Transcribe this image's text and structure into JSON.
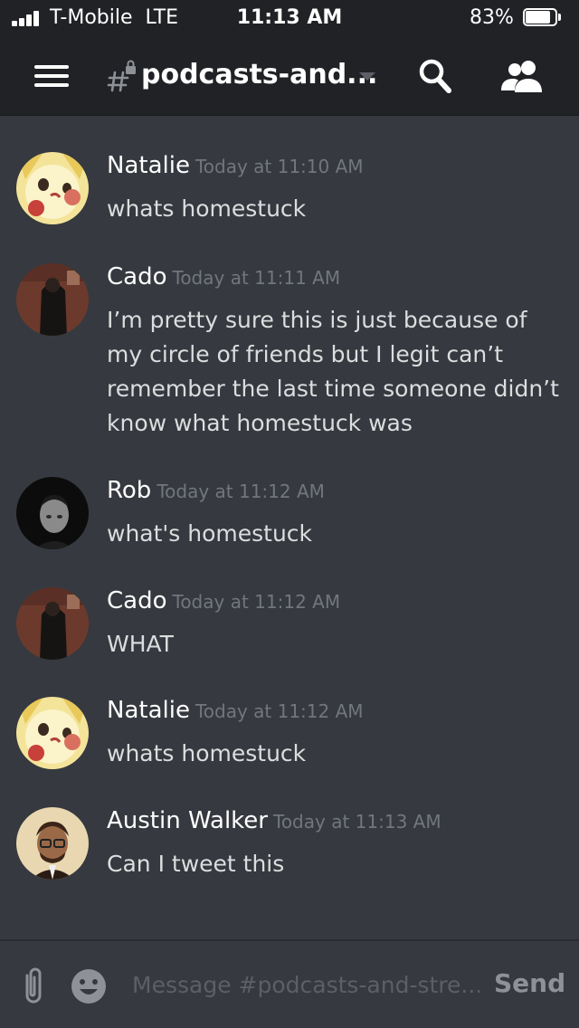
{
  "status_bar": {
    "carrier": "T-Mobile  LTE",
    "time": "11:13 AM",
    "battery": "83%",
    "battery_level": 0.83
  },
  "header": {
    "channel_name": "podcasts-and...",
    "icons": [
      "menu-icon",
      "locked-hash-icon",
      "chevron-down-icon",
      "search-icon",
      "members-icon"
    ]
  },
  "messages": [
    {
      "author": "Natalie",
      "timestamp": "Today at 11:10 AM",
      "text": "whats homestuck"
    },
    {
      "author": "Cado",
      "timestamp": "Today at 11:11 AM",
      "text": "I’m pretty sure this is just because of\nmy circle of friends but I legit can’t\nremember the last time someone didn’t\nknow what homestuck was"
    },
    {
      "author": "Rob",
      "timestamp": "Today at 11:12 AM",
      "text": "what's homestuck"
    },
    {
      "author": "Cado",
      "timestamp": "Today at 11:12 AM",
      "text": "WHAT"
    },
    {
      "author": "Natalie",
      "timestamp": "Today at 11:12 AM",
      "text": "whats homestuck"
    },
    {
      "author": "Austin Walker",
      "timestamp": "Today at 11:13 AM",
      "text": "Can I tweet this"
    }
  ],
  "composer": {
    "placeholder": "Message #podcasts-and-stre...",
    "send_label": "Send",
    "icons": [
      "attach-icon",
      "emoji-icon"
    ]
  },
  "colors": {
    "background": "#36393f",
    "header": "#202225",
    "username": "#ffffff",
    "timestamp": "#72767d",
    "message_text": "#dcddde"
  }
}
